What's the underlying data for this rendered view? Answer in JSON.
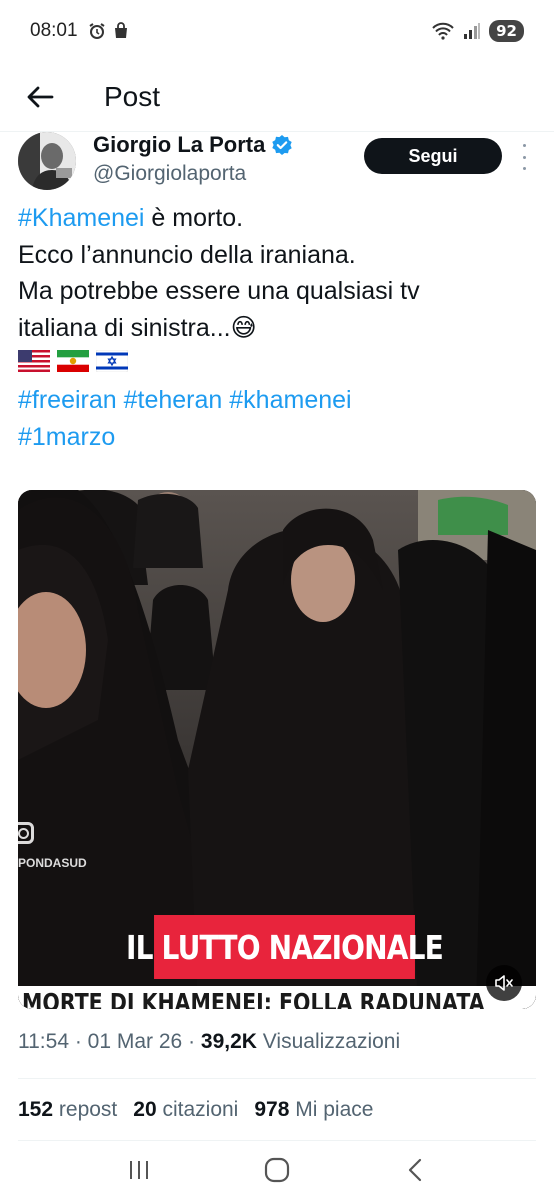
{
  "status_bar": {
    "time": "08:01",
    "battery": "92"
  },
  "header": {
    "title": "Post"
  },
  "author": {
    "name": "Giorgio La Porta",
    "handle": "@Giorgiolaporta",
    "follow_label": "Segui"
  },
  "post": {
    "line1_hashtag": "#Khamenei",
    "line1_rest": " è morto.",
    "line2": "Ecco l’annuncio della iraniana.",
    "line3": "Ma potrebbe essere una qualsiasi tv",
    "line4": "italiana di sinistra...",
    "emoji": "😅",
    "hashtags_row1": [
      "#freeiran",
      "#teheran",
      "#khamenei"
    ],
    "hashtags_row2": [
      "#1marzo"
    ]
  },
  "media": {
    "banner": "IL LUTTO NAZIONALE",
    "watermark": "PONDASUD",
    "subtitle": "MORTE DI KHAMENEI: FOLLA RADUNATA"
  },
  "meta": {
    "time": "11:54",
    "sep1": " · ",
    "date": "01 Mar 26",
    "sep2": " · ",
    "views_count": "39,2K",
    "views_label": " Visualizzazioni"
  },
  "stats": {
    "reposts_count": "152",
    "reposts_label": "repost",
    "quotes_count": "20",
    "quotes_label": "citazioni",
    "likes_count": "978",
    "likes_label": "Mi piace"
  },
  "colors": {
    "hashtag": "#1d9bf0",
    "verified": "#1d9bf0",
    "banner": "#e8243c"
  }
}
